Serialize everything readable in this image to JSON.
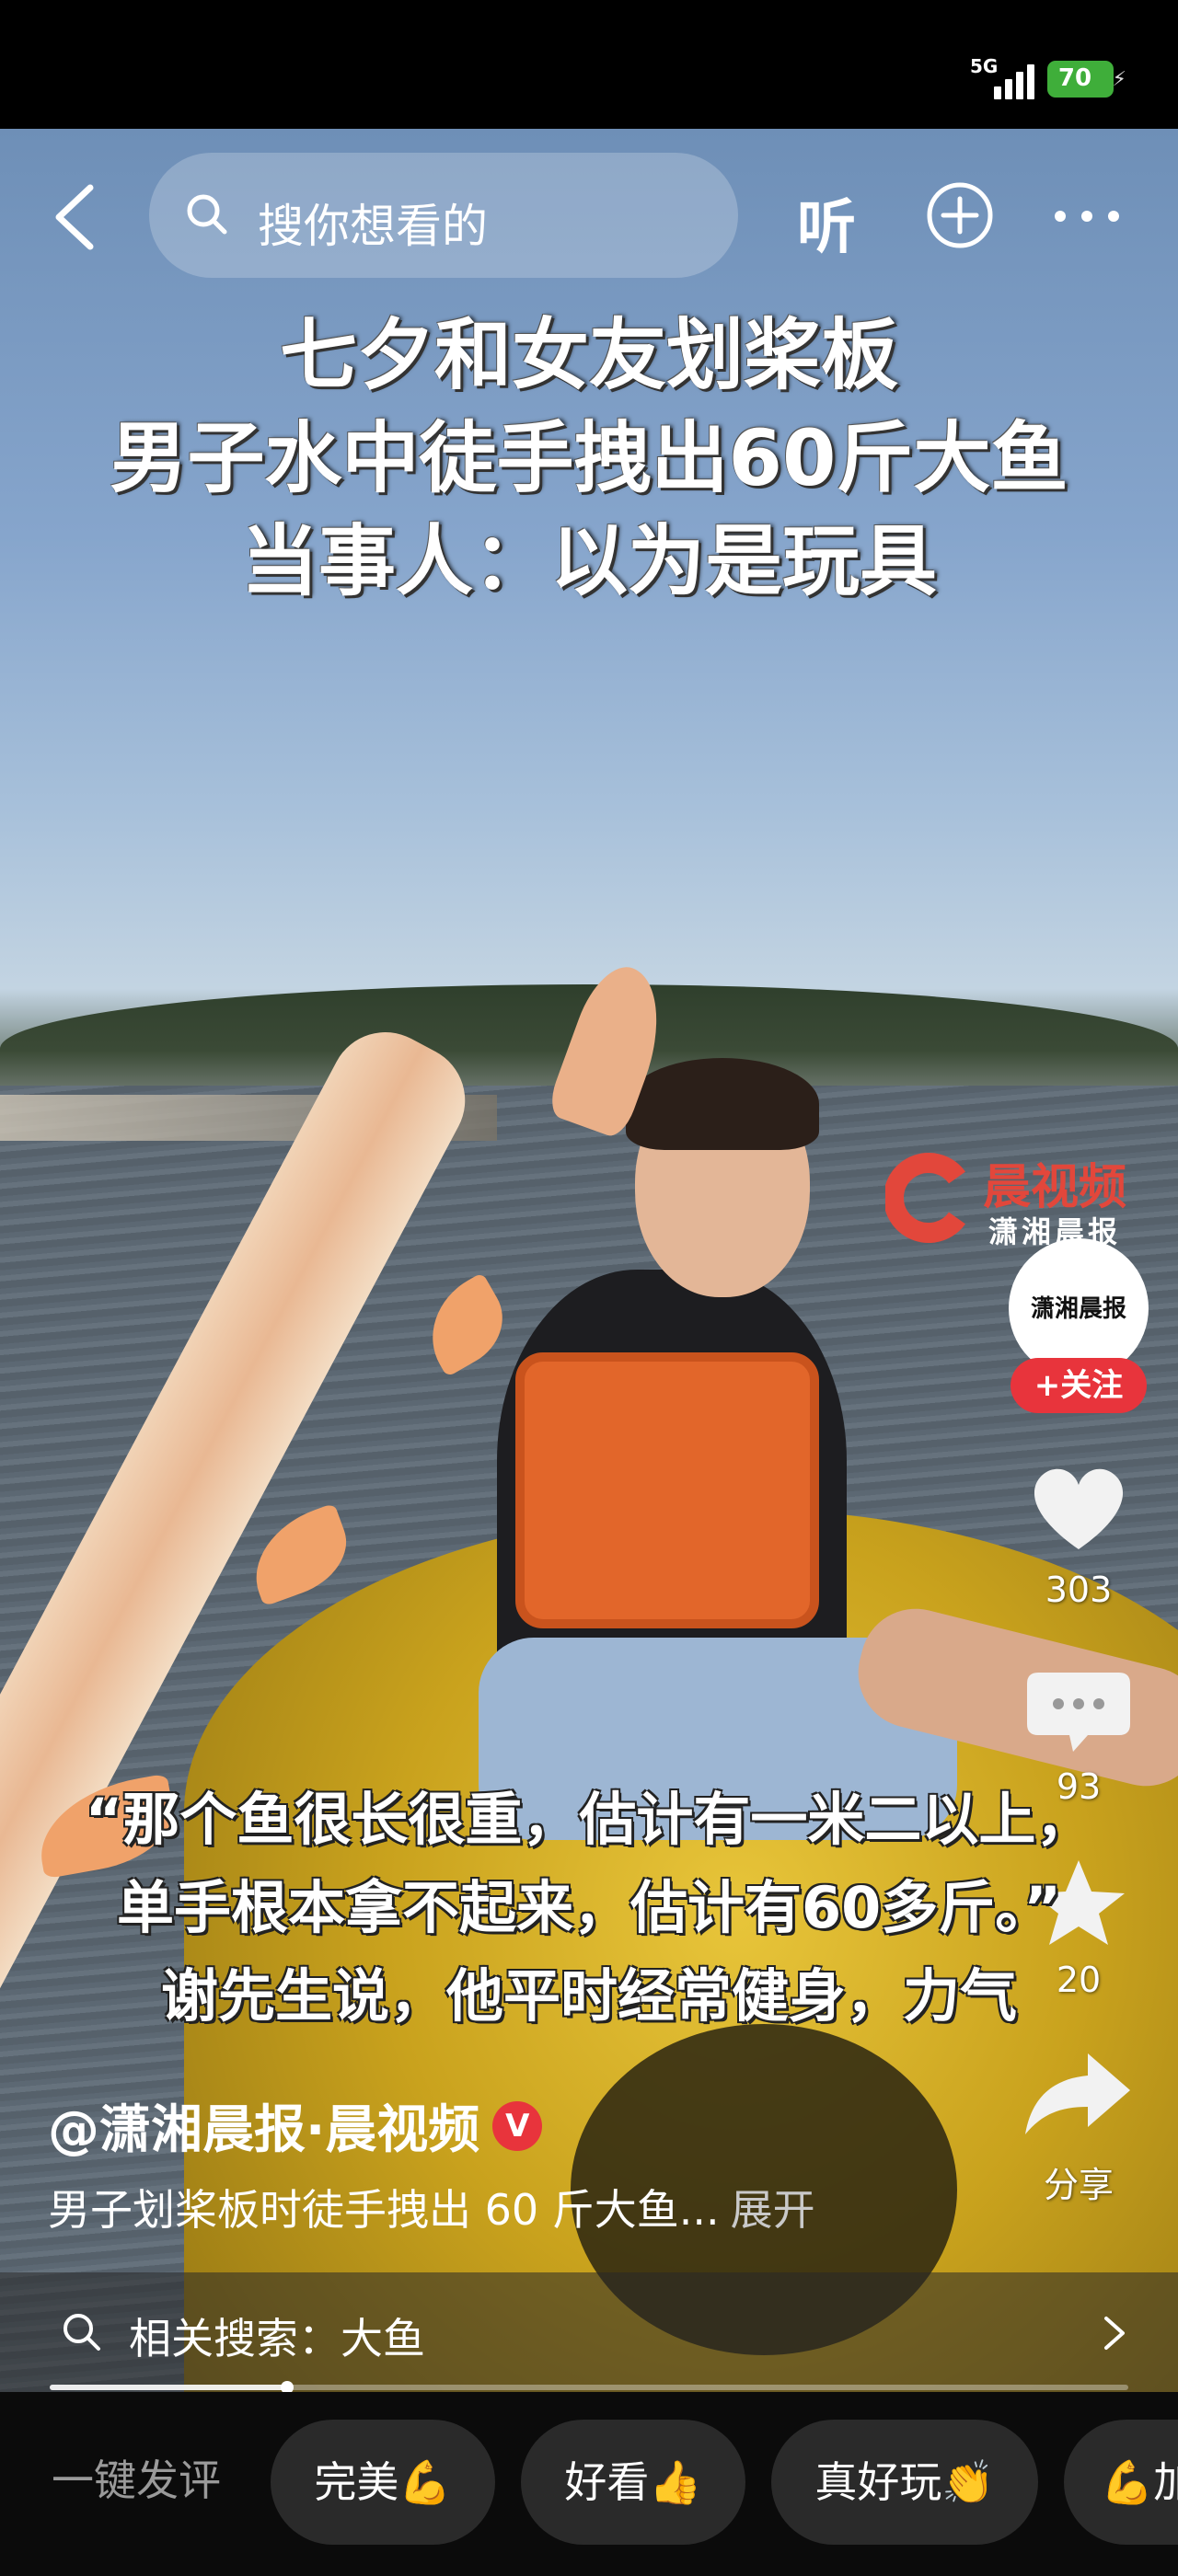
{
  "status_bar": {
    "network": "5G",
    "battery": "70"
  },
  "top_nav": {
    "search_placeholder": "搜你想看的",
    "listen_label": "听"
  },
  "headline": [
    "七夕和女友划桨板",
    "男子水中徒手拽出60斤大鱼",
    "当事人：以为是玩具"
  ],
  "watermark": {
    "title": "晨视频",
    "subtitle": "潇湘晨报"
  },
  "right_rail": {
    "avatar_text": "潇湘晨报",
    "follow_label": "+关注",
    "like_count": "303",
    "comment_count": "93",
    "favorite_count": "20",
    "share_label": "分享"
  },
  "caption": [
    "“那个鱼很长很重，估计有一米二以上，",
    "单手根本拿不起来，估计有60多斤。”",
    "谢先生说，他平时经常健身，力气"
  ],
  "author": {
    "name": "@潇湘晨报·晨视频",
    "verified": "V"
  },
  "description": {
    "text": "男子划桨板时徒手拽出 60 斤大鱼...",
    "expand": "展开"
  },
  "related_search": {
    "text": "相关搜索：大鱼"
  },
  "progress": {
    "played_fraction": 0.22
  },
  "quick_comment": {
    "label": "一键发评",
    "chips": [
      "完美💪",
      "好看👍",
      "真好玩👏",
      "💪加油"
    ]
  },
  "colors": {
    "accent_red": "#e8343c",
    "battery_green": "#3fae3a"
  }
}
